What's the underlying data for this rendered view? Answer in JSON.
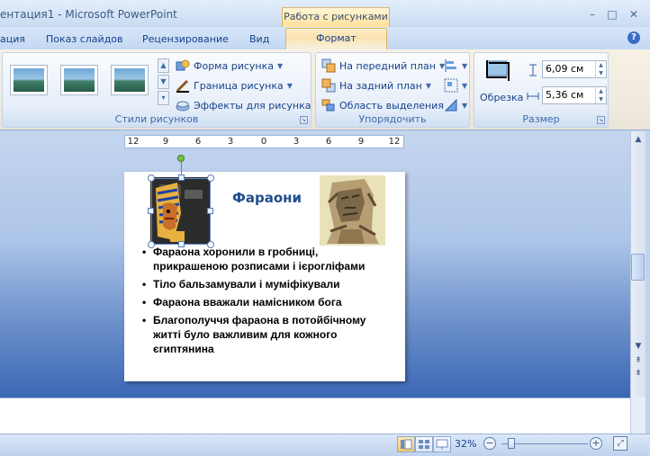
{
  "window": {
    "title": "ентация1 - Microsoft PowerPoint",
    "context_tab_header": "Работа с рисунками",
    "min_glyph": "–",
    "max_glyph": "□",
    "close_glyph": "✕"
  },
  "tabs": {
    "items": [
      "ация",
      "Показ слайдов",
      "Рецензирование",
      "Вид"
    ],
    "active": "Формат",
    "help": "?"
  },
  "ribbon": {
    "styles_group": {
      "label": "Стили рисунков",
      "shape": "Форма рисунка",
      "border": "Граница рисунка",
      "effects": "Эффекты для рисунка"
    },
    "arrange_group": {
      "label": "Упорядочить",
      "bring_front": "На передний план",
      "send_back": "На задний план",
      "selection_pane": "Область выделения"
    },
    "size_group": {
      "label": "Размер",
      "crop": "Обрезка",
      "height": "6,09 см",
      "width": "5,36 см"
    }
  },
  "ruler": {
    "ticks": [
      "12",
      "9",
      "6",
      "3",
      "0",
      "3",
      "6",
      "9",
      "12"
    ]
  },
  "slide": {
    "title": "Фараони",
    "bullets": [
      "Фараона хоронили в гробниці, прикрашеною розписами і ієрогліфами",
      "Тіло бальзамували і муміфікували",
      "Фараона вважали намісником бога",
      "Благополуччя фараона в потойбічному житті було важливим для кожного єгиптянина"
    ]
  },
  "status": {
    "zoom": "32%"
  },
  "colors": {
    "accent": "#15428b",
    "context_tab": "#ffe19a",
    "slide_title": "#1f4e8c"
  }
}
